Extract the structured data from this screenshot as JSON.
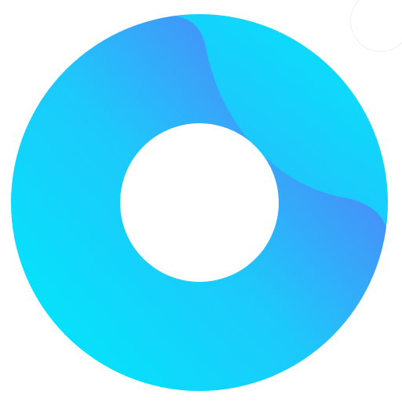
{
  "logo": {
    "icon": "ring-logo-icon",
    "colors": {
      "cyan": "#00e8fb",
      "sky": "#1cc9fb",
      "blue": "#4a8cf8",
      "violet": "#5f67f5",
      "background": "#ffffff"
    }
  }
}
